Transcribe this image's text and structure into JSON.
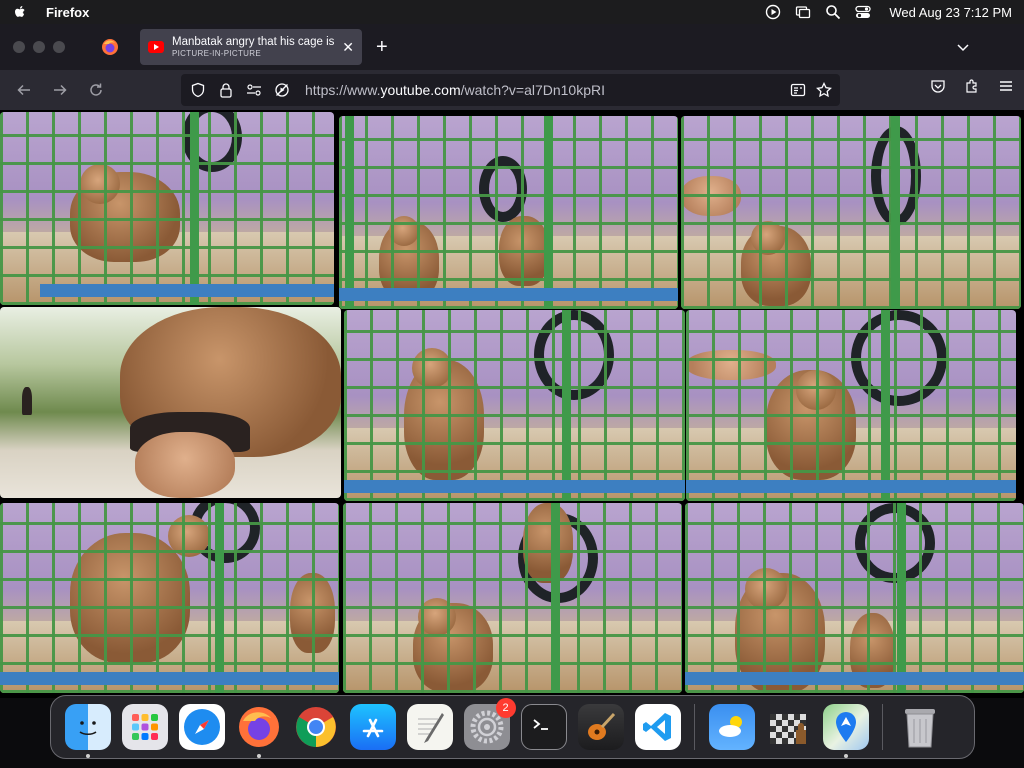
{
  "menubar": {
    "app_name": "Firefox",
    "clock": "Wed Aug 23  7:12 PM"
  },
  "tabs": {
    "active_title": "Manbatak angry that his cage is",
    "active_subtitle": "PICTURE-IN-PICTURE",
    "new_tab": "+"
  },
  "navbar": {
    "url_prefix": "https://www.",
    "url_domain": "youtube.com",
    "url_path": "/watch?v=al7Dn10kpRI"
  },
  "dock": {
    "items": [
      {
        "name": "finder",
        "running": true
      },
      {
        "name": "launchpad",
        "running": false
      },
      {
        "name": "safari",
        "running": false
      },
      {
        "name": "firefox",
        "running": true
      },
      {
        "name": "chrome",
        "running": false
      },
      {
        "name": "app-store",
        "running": false
      },
      {
        "name": "textedit",
        "running": false
      },
      {
        "name": "system-settings",
        "running": false,
        "badge": "2"
      },
      {
        "name": "terminal",
        "running": false
      },
      {
        "name": "garageband",
        "running": false
      },
      {
        "name": "vscode",
        "running": false
      },
      {
        "name": "weather",
        "running": false
      },
      {
        "name": "chess",
        "running": false
      },
      {
        "name": "maps",
        "running": true
      },
      {
        "name": "trash",
        "running": false
      }
    ]
  },
  "colors": {
    "menubar_bg": "#1c1c1e",
    "tabstrip_bg": "#1c1b22",
    "active_tab_bg": "#42414d",
    "navbar_bg": "#2b2a33",
    "urlbar_bg": "#1c1b22",
    "cage_green": "#3f9a4a",
    "youtube_red": "#ff0000"
  }
}
